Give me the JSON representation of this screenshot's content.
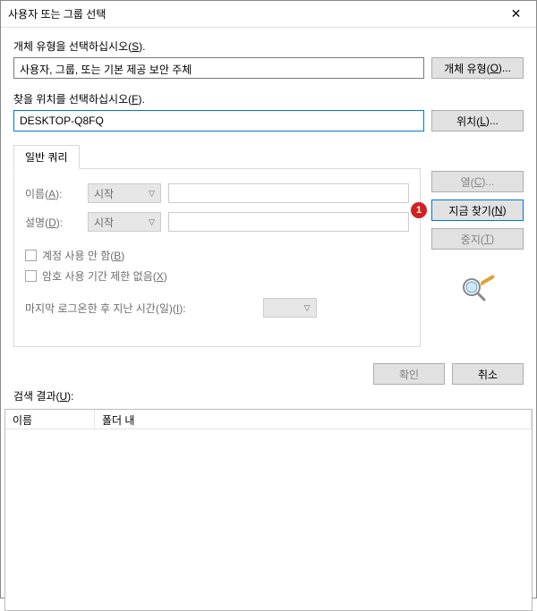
{
  "titlebar": {
    "title": "사용자 또는 그룹 선택"
  },
  "section1": {
    "label": "개체 유형을 선택하십시오(S).",
    "value": "사용자, 그룹, 또는 기본 제공 보안 주체",
    "button": "개체 유형(O)..."
  },
  "section2": {
    "label": "찾을 위치를 선택하십시오(F).",
    "value": "DESKTOP-Q8FQ",
    "button": "위치(L)..."
  },
  "tab": {
    "label": "일반 쿼리"
  },
  "form": {
    "name_label": "이름(A):",
    "name_combo": "시작",
    "desc_label": "설명(D):",
    "desc_combo": "시작",
    "check1": "계정 사용 안 함(B)",
    "check2": "암호 사용 기간 제한 없음(X)",
    "last_login": "마지막 로그온한 후 지난 시간(일)(I):"
  },
  "side_buttons": {
    "columns": "열(C)...",
    "find_now": "지금 찾기(N)",
    "stop": "중지(T)"
  },
  "callout": {
    "number": "1"
  },
  "bottom": {
    "ok": "확인",
    "cancel": "취소"
  },
  "results": {
    "label": "검색 결과(U):",
    "col_name": "이름",
    "col_folder": "폴더 내"
  }
}
